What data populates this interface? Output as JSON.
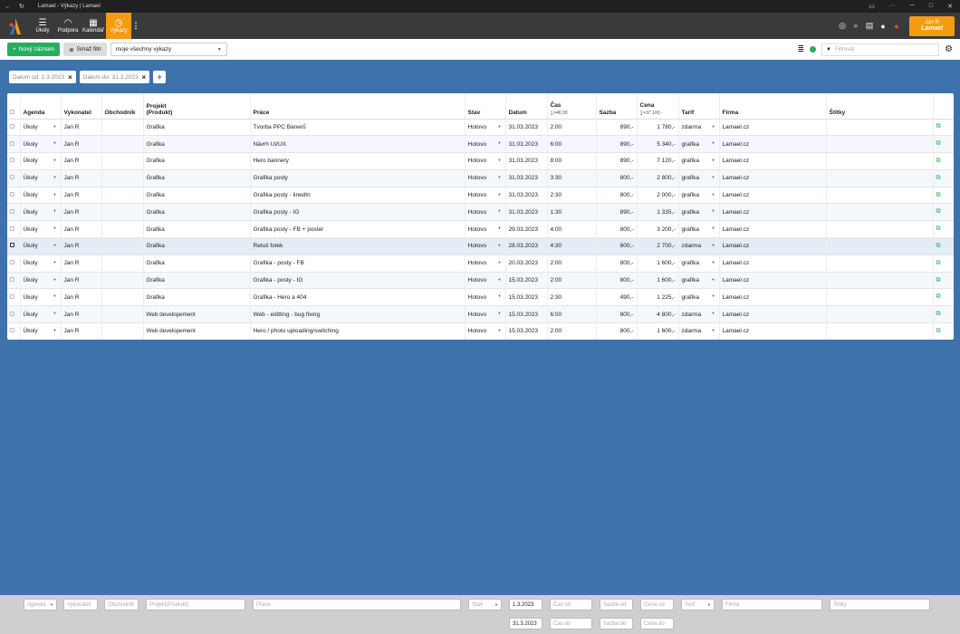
{
  "window": {
    "title": "Lamael - Výkazy | Lamael"
  },
  "nav": {
    "items": [
      {
        "label": "Úkoly",
        "icon": "list-icon"
      },
      {
        "label": "Podpora",
        "icon": "headset-icon"
      },
      {
        "label": "Kalendář",
        "icon": "calendar-icon"
      },
      {
        "label": "Výkazy",
        "icon": "clock-icon"
      }
    ],
    "user": {
      "name": "Jan R",
      "company": "Lamael"
    }
  },
  "toolbar": {
    "new_label": "Nový záznam",
    "clear_filter_label": "Smaž filtr",
    "view_select": "moje všechny výkazy",
    "filter_placeholder": "Filtrovat"
  },
  "chips": {
    "date_from": "Datum od: 1.3.2023",
    "date_to": "Datum do: 31.3.2023"
  },
  "table": {
    "headers": {
      "agenda": "Agenda",
      "vykonatel": "Vykonatel",
      "obchodnik": "Obchodník",
      "projekt": "Projekt",
      "projekt2": "(Produkt)",
      "prace": "Práce",
      "stav": "Stav",
      "datum": "Datum",
      "cas": "Čas",
      "cas_sum": "∑=46:30",
      "sazba": "Sazba",
      "cena": "Cena",
      "cena_sum": "∑=37 100,-",
      "tarif": "Tarif",
      "firma": "Firma",
      "stitky": "Štítky"
    },
    "rows": [
      {
        "agenda": "Úkoly",
        "vykonatel": "Jan R",
        "projekt": "Grafika",
        "prace": "Tvorba PPC Banerů",
        "stav": "Hotovo",
        "datum": "31.03.2023",
        "cas": "2:00",
        "sazba": "890,-",
        "cena": "1 780,-",
        "tarif": "zdarma",
        "firma": "Lamael.cz"
      },
      {
        "agenda": "Úkoly",
        "vykonatel": "Jan R",
        "projekt": "Grafika",
        "prace": "Návrh UI/UX",
        "stav": "Hotovo",
        "datum": "31.03.2023",
        "cas": "6:00",
        "sazba": "890,-",
        "cena": "5 340,-",
        "tarif": "grafika",
        "firma": "Lamael.cz"
      },
      {
        "agenda": "Úkoly",
        "vykonatel": "Jan R",
        "projekt": "Grafika",
        "prace": "Hero bannery",
        "stav": "Hotovo",
        "datum": "31.03.2023",
        "cas": "8:00",
        "sazba": "890,-",
        "cena": "7 120,-",
        "tarif": "grafika",
        "firma": "Lamael.cz"
      },
      {
        "agenda": "Úkoly",
        "vykonatel": "Jan R",
        "projekt": "Grafika",
        "prace": "Grafika posty",
        "stav": "Hotovo",
        "datum": "31.03.2023",
        "cas": "3:30",
        "sazba": "800,-",
        "cena": "2 800,-",
        "tarif": "grafika",
        "firma": "Lamael.cz"
      },
      {
        "agenda": "Úkoly",
        "vykonatel": "Jan R",
        "projekt": "Grafika",
        "prace": "Grafika posty - linedIn",
        "stav": "Hotovo",
        "datum": "31.03.2023",
        "cas": "2:30",
        "sazba": "800,-",
        "cena": "2 000,-",
        "tarif": "grafika",
        "firma": "Lamael.cz"
      },
      {
        "agenda": "Úkoly",
        "vykonatel": "Jan R",
        "projekt": "Grafika",
        "prace": "Grafika posty - IG",
        "stav": "Hotovo",
        "datum": "31.03.2023",
        "cas": "1:30",
        "sazba": "890,-",
        "cena": "1 335,-",
        "tarif": "grafika",
        "firma": "Lamael.cz"
      },
      {
        "agenda": "Úkoly",
        "vykonatel": "Jan R",
        "projekt": "Grafika",
        "prace": "Grafika posty - FB + poster",
        "stav": "Hotovo",
        "datum": "29.03.2023",
        "cas": "4:00",
        "sazba": "800,-",
        "cena": "3 200,-",
        "tarif": "grafika",
        "firma": "Lamael.cz"
      },
      {
        "agenda": "Úkoly",
        "vykonatel": "Jan R",
        "projekt": "Grafika",
        "prace": "Retuš fotek",
        "stav": "Hotovo",
        "datum": "28.03.2023",
        "cas": "4:30",
        "sazba": "600,-",
        "cena": "2 700,-",
        "tarif": "zdarma",
        "firma": "Lamael.cz"
      },
      {
        "agenda": "Úkoly",
        "vykonatel": "Jan R",
        "projekt": "Grafika",
        "prace": "Grafika - posty - FB",
        "stav": "Hotovo",
        "datum": "20.03.2023",
        "cas": "2:00",
        "sazba": "800,-",
        "cena": "1 600,-",
        "tarif": "grafika",
        "firma": "Lamael.cz"
      },
      {
        "agenda": "Úkoly",
        "vykonatel": "Jan R",
        "projekt": "Grafika",
        "prace": "Grafika - posty - IG",
        "stav": "Hotovo",
        "datum": "15.03.2023",
        "cas": "2:00",
        "sazba": "800,-",
        "cena": "1 600,-",
        "tarif": "grafika",
        "firma": "Lamael.cz"
      },
      {
        "agenda": "Úkoly",
        "vykonatel": "Jan R",
        "projekt": "Grafika",
        "prace": "Grafika - Hero a 404",
        "stav": "Hotovo",
        "datum": "15.03.2023",
        "cas": "2:30",
        "sazba": "490,-",
        "cena": "1 225,-",
        "tarif": "grafika",
        "firma": "Lamael.cz"
      },
      {
        "agenda": "Úkoly",
        "vykonatel": "Jan R",
        "projekt": "Web developement",
        "prace": "Web - editting - bug fixing",
        "stav": "Hotovo",
        "datum": "15.03.2023",
        "cas": "6:00",
        "sazba": "800,-",
        "cena": "4 800,-",
        "tarif": "zdarma",
        "firma": "Lamael.cz"
      },
      {
        "agenda": "Úkoly",
        "vykonatel": "Jan R",
        "projekt": "Web developement",
        "prace": "Hero / photo uploading/switching",
        "stav": "Hotovo",
        "datum": "15.03.2023",
        "cas": "2:00",
        "sazba": "800,-",
        "cena": "1 600,-",
        "tarif": "zdarma",
        "firma": "Lamael.cz"
      }
    ]
  },
  "bottom_filters": {
    "agenda": "Agenda",
    "vykonatel": "Vykonatel",
    "obchodnik": "Obchodník",
    "projekt": "Projekt(Produkt)",
    "prace": "Práce",
    "stav": "Stav",
    "datum_od": "1.3.2023",
    "datum_do": "31.3.2023",
    "cas_od": "Čas od",
    "cas_do": "Čas do",
    "sazba_od": "Sazba od",
    "sazba_do": "Sazba do",
    "cena_od": "Cena od",
    "cena_do": "Cena do",
    "tarif": "Tarif",
    "firma": "Firma",
    "stitky": "Štítky"
  },
  "colors": {
    "accent": "#f39c12",
    "background": "#3d72ad",
    "success": "#27ae60",
    "navbar": "#3a3a3a"
  }
}
